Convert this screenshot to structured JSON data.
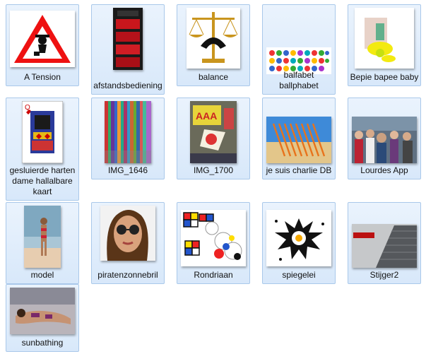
{
  "files": [
    {
      "name": "A Tension",
      "thumb": "warning-sign-icon"
    },
    {
      "name": "afstandsbediening",
      "thumb": "remote-control-image"
    },
    {
      "name": "balance",
      "thumb": "balance-scale-image"
    },
    {
      "name": "balfabet ballphabet",
      "thumb": "alphabet-balls-image"
    },
    {
      "name": "Bepie bapee baby",
      "thumb": "baby-figure-image"
    },
    {
      "name": "gesluierde harten dame hallalbare kaart",
      "thumb": "playing-card-image"
    },
    {
      "name": "IMG_1646",
      "thumb": "colored-strips-photo"
    },
    {
      "name": "IMG_1700",
      "thumb": "comic-collage-photo"
    },
    {
      "name": "je suis charlie DB",
      "thumb": "pencils-image"
    },
    {
      "name": "Lourdes App",
      "thumb": "crowd-photo"
    },
    {
      "name": "model",
      "thumb": "beach-model-photo"
    },
    {
      "name": "piratenzonnebril",
      "thumb": "sunglasses-portrait-photo"
    },
    {
      "name": "Rondriaan",
      "thumb": "mondrian-circles-image"
    },
    {
      "name": "spiegelei",
      "thumb": "fried-egg-splash-image"
    },
    {
      "name": "Stijger2",
      "thumb": "skyscraper-photo"
    },
    {
      "name": "sunbathing",
      "thumb": "sunbathing-photo"
    }
  ]
}
